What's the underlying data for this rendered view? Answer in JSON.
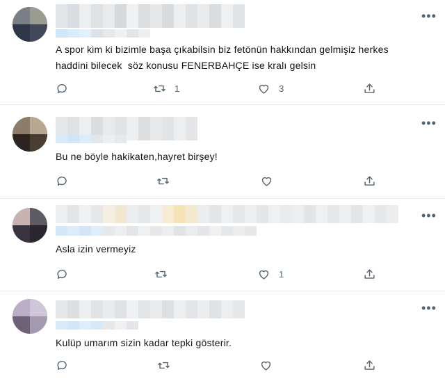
{
  "tweets": [
    {
      "text": "A spor kim ki bizimle başa çıkabilsin biz fetönün hakkından gelmişiz herkes\nhaddini bilecek  söz konusu FENERBAHÇE ise kralı gelsin",
      "reply_count": "",
      "retweet_count": "1",
      "like_count": "3"
    },
    {
      "text": "Bu ne böyle hakikaten,hayret birşey!",
      "reply_count": "",
      "retweet_count": "",
      "like_count": ""
    },
    {
      "text": "Asla izin vermeyiz",
      "reply_count": "",
      "retweet_count": "",
      "like_count": "1"
    },
    {
      "text": "Kulüp umarım sizin kadar tepki gösterir.",
      "reply_count": "",
      "retweet_count": "",
      "like_count": ""
    }
  ],
  "more_glyph": "•••",
  "icons": {
    "reply": "reply-icon",
    "retweet": "retweet-icon",
    "like": "heart-icon",
    "share": "share-icon"
  },
  "colors": {
    "icon": "#536471",
    "text": "#0f1419",
    "divider": "#e6ecf0",
    "blur_light": "#dfe3e8",
    "blur_blue": "#cfe6f8"
  }
}
